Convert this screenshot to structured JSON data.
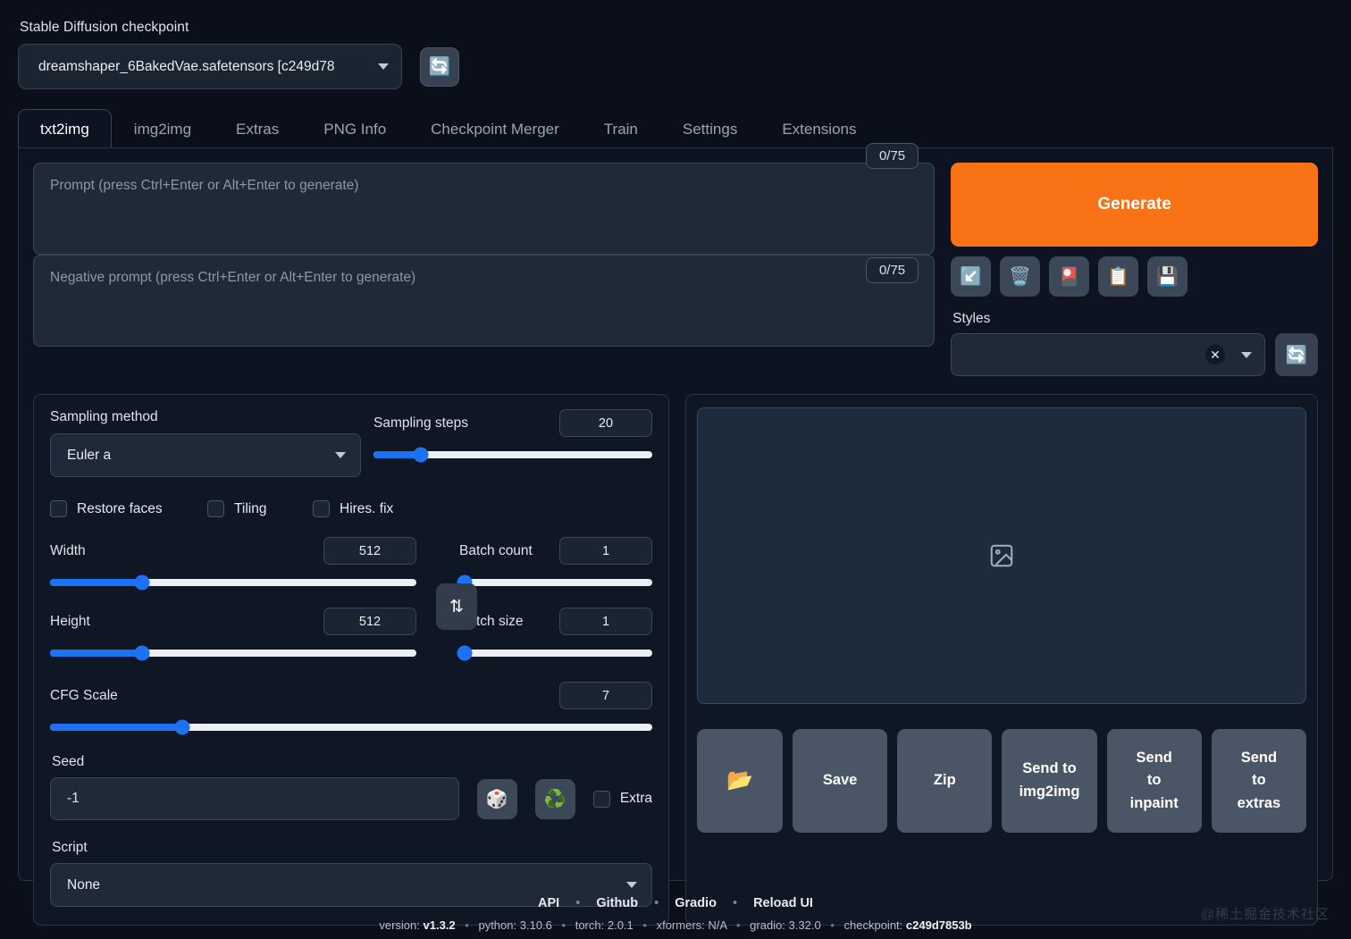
{
  "checkpoint": {
    "label": "Stable Diffusion checkpoint",
    "value": "dreamshaper_6BakedVae.safetensors [c249d78",
    "refresh_icon": "🔄"
  },
  "tabs": [
    {
      "label": "txt2img",
      "active": true
    },
    {
      "label": "img2img",
      "active": false
    },
    {
      "label": "Extras",
      "active": false
    },
    {
      "label": "PNG Info",
      "active": false
    },
    {
      "label": "Checkpoint Merger",
      "active": false
    },
    {
      "label": "Train",
      "active": false
    },
    {
      "label": "Settings",
      "active": false
    },
    {
      "label": "Extensions",
      "active": false
    }
  ],
  "prompt": {
    "placeholder": "Prompt (press Ctrl+Enter or Alt+Enter to generate)",
    "value": "",
    "token_counter": "0/75"
  },
  "negative_prompt": {
    "placeholder": "Negative prompt (press Ctrl+Enter or Alt+Enter to generate)",
    "value": "",
    "token_counter": "0/75"
  },
  "generate": {
    "label": "Generate",
    "color": "#f97316"
  },
  "toolbar_icons": [
    {
      "name": "arrow-down-left-icon",
      "glyph": "↙️"
    },
    {
      "name": "trash-icon",
      "glyph": "🗑️"
    },
    {
      "name": "picture-icon",
      "glyph": "🎴"
    },
    {
      "name": "clipboard-icon",
      "glyph": "📋"
    },
    {
      "name": "floppy-save-icon",
      "glyph": "💾"
    }
  ],
  "styles": {
    "label": "Styles",
    "value": "",
    "clear_glyph": "✕",
    "refresh_icon": "🔄"
  },
  "sampling": {
    "method_label": "Sampling method",
    "method_value": "Euler a",
    "steps_label": "Sampling steps",
    "steps_value": "20",
    "steps_percent": 17
  },
  "checkboxes": [
    {
      "label": "Restore faces",
      "checked": false
    },
    {
      "label": "Tiling",
      "checked": false
    },
    {
      "label": "Hires. fix",
      "checked": false
    }
  ],
  "dimensions": {
    "width_label": "Width",
    "width_value": "512",
    "width_percent": 25,
    "height_label": "Height",
    "height_value": "512",
    "height_percent": 25,
    "swap_glyph": "⇅"
  },
  "batch": {
    "count_label": "Batch count",
    "count_value": "1",
    "count_percent": 3,
    "size_label": "Batch size",
    "size_value": "1",
    "size_percent": 3
  },
  "cfg": {
    "label": "CFG Scale",
    "value": "7",
    "percent": 22
  },
  "seed": {
    "label": "Seed",
    "value": "-1",
    "dice_icon": "🎲",
    "recycle_icon": "♻️",
    "extra_label": "Extra",
    "extra_checked": false
  },
  "script": {
    "label": "Script",
    "value": "None"
  },
  "preview": {
    "placeholder_icon": "image-placeholder"
  },
  "actions": [
    {
      "name": "open-folder-button",
      "label": "📂",
      "is_icon": true
    },
    {
      "name": "save-button",
      "label": "Save",
      "is_icon": false
    },
    {
      "name": "zip-button",
      "label": "Zip",
      "is_icon": false
    },
    {
      "name": "send-to-img2img-button",
      "label": "Send to\nimg2img",
      "is_icon": false
    },
    {
      "name": "send-to-inpaint-button",
      "label": "Send\nto\ninpaint",
      "is_icon": false
    },
    {
      "name": "send-to-extras-button",
      "label": "Send\nto\nextras",
      "is_icon": false
    }
  ],
  "footer": {
    "links": [
      "API",
      "Github",
      "Gradio",
      "Reload UI"
    ],
    "separator": "•",
    "versions": [
      {
        "key": "version:",
        "val": "v1.3.2"
      },
      {
        "key": "python:",
        "val": "3.10.6"
      },
      {
        "key": "torch:",
        "val": "2.0.1"
      },
      {
        "key": "xformers:",
        "val": "N/A"
      },
      {
        "key": "gradio:",
        "val": "3.32.0"
      },
      {
        "key": "checkpoint:",
        "val": "c249d7853b"
      }
    ]
  },
  "watermark": "@稀土掘金技术社区"
}
